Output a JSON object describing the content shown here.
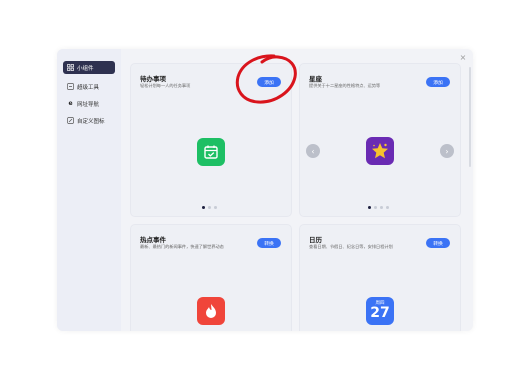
{
  "sidebar": {
    "items": [
      {
        "label": "小组件",
        "icon": "grid-icon"
      },
      {
        "label": "超级工具",
        "icon": "tools-icon"
      },
      {
        "label": "网址导航",
        "icon": "browser-icon"
      },
      {
        "label": "自定义图标",
        "icon": "custom-icon"
      }
    ]
  },
  "dialog": {
    "close_icon": "close-icon"
  },
  "cards": [
    {
      "title": "待办事项",
      "desc": "轻松计划每一人的任务事项",
      "button": "添加",
      "icon": "calendar-check-icon",
      "icon_color": "#1dbf64"
    },
    {
      "title": "星座",
      "desc": "提供关于十二星座的性格特点、运势等",
      "button": "添加",
      "icon": "star-icon",
      "icon_color": "#6a2bb3"
    },
    {
      "title": "热点事件",
      "desc": "最新、最热门的新闻事件，快速了解世界动态",
      "button": "转换",
      "icon": "fire-icon",
      "icon_color": "#f0453a"
    },
    {
      "title": "日历",
      "desc": "查看日期、节假日、纪念日等，安排日程计划",
      "button": "转换",
      "icon_header": "周四",
      "icon_day": "27",
      "icon_color": "#3b73f5"
    }
  ],
  "annotation": {
    "color": "#d9141c"
  }
}
